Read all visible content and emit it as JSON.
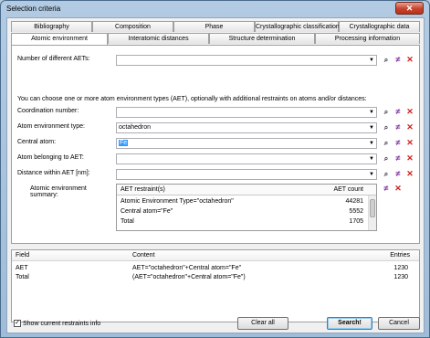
{
  "window": {
    "title": "Selection criteria",
    "close_glyph": "✕"
  },
  "tabs_row1": [
    "Bibliography",
    "Composition",
    "Phase",
    "Crystallographic classifications",
    "Crystallographic data"
  ],
  "tabs_row2": [
    "Atomic environment",
    "Interatomic distances",
    "Structure determination",
    "Processing information"
  ],
  "active_tab": "Atomic environment",
  "fields": {
    "num_aets": {
      "label": "Number of different AETs:",
      "value": ""
    },
    "info": "You can choose one or more atom environment types (AET), optionally with additional restraints on atoms and/or distances:",
    "coordination": {
      "label": "Coordination number:",
      "value": ""
    },
    "aet_type": {
      "label": "Atom environment type:",
      "value": "octahedron"
    },
    "central_atom": {
      "label": "Central atom:",
      "value": "Fe"
    },
    "atom_belonging": {
      "label": "Atom belonging to AET:",
      "value": ""
    },
    "distance": {
      "label": "Distance within AET [nm]:",
      "value": ""
    },
    "summary_label": "Atomic environment summary:"
  },
  "summary": {
    "columns": [
      "AET restraint(s)",
      "AET count"
    ],
    "rows": [
      {
        "restraint": "Atomic Environment Type=\"octahedron\"",
        "count": "44281"
      },
      {
        "restraint": "Central atom=\"Fe\"",
        "count": "5552"
      },
      {
        "restraint": "Total",
        "count": "1705"
      }
    ]
  },
  "results": {
    "columns": [
      "Field",
      "Content",
      "Entries"
    ],
    "rows": [
      {
        "field": "AET",
        "content": "AET=\"octahedron\"+Central atom=\"Fe\"",
        "entries": "1230"
      },
      {
        "field": "Total",
        "content": "(AET=\"octahedron\"+Central atom=\"Fe\")",
        "entries": "1230"
      }
    ]
  },
  "footer": {
    "show_info_label": "Show current restraints info",
    "show_info_checked": true,
    "clear_all": "Clear all",
    "search": "Search!",
    "cancel": "Cancel"
  },
  "icons": {
    "find": "find-icon",
    "neq": "not-equal-icon",
    "del": "delete-icon"
  },
  "colors": {
    "selection": "#3399ff",
    "delete": "#d0201e",
    "neq": "#7a2a9a"
  }
}
